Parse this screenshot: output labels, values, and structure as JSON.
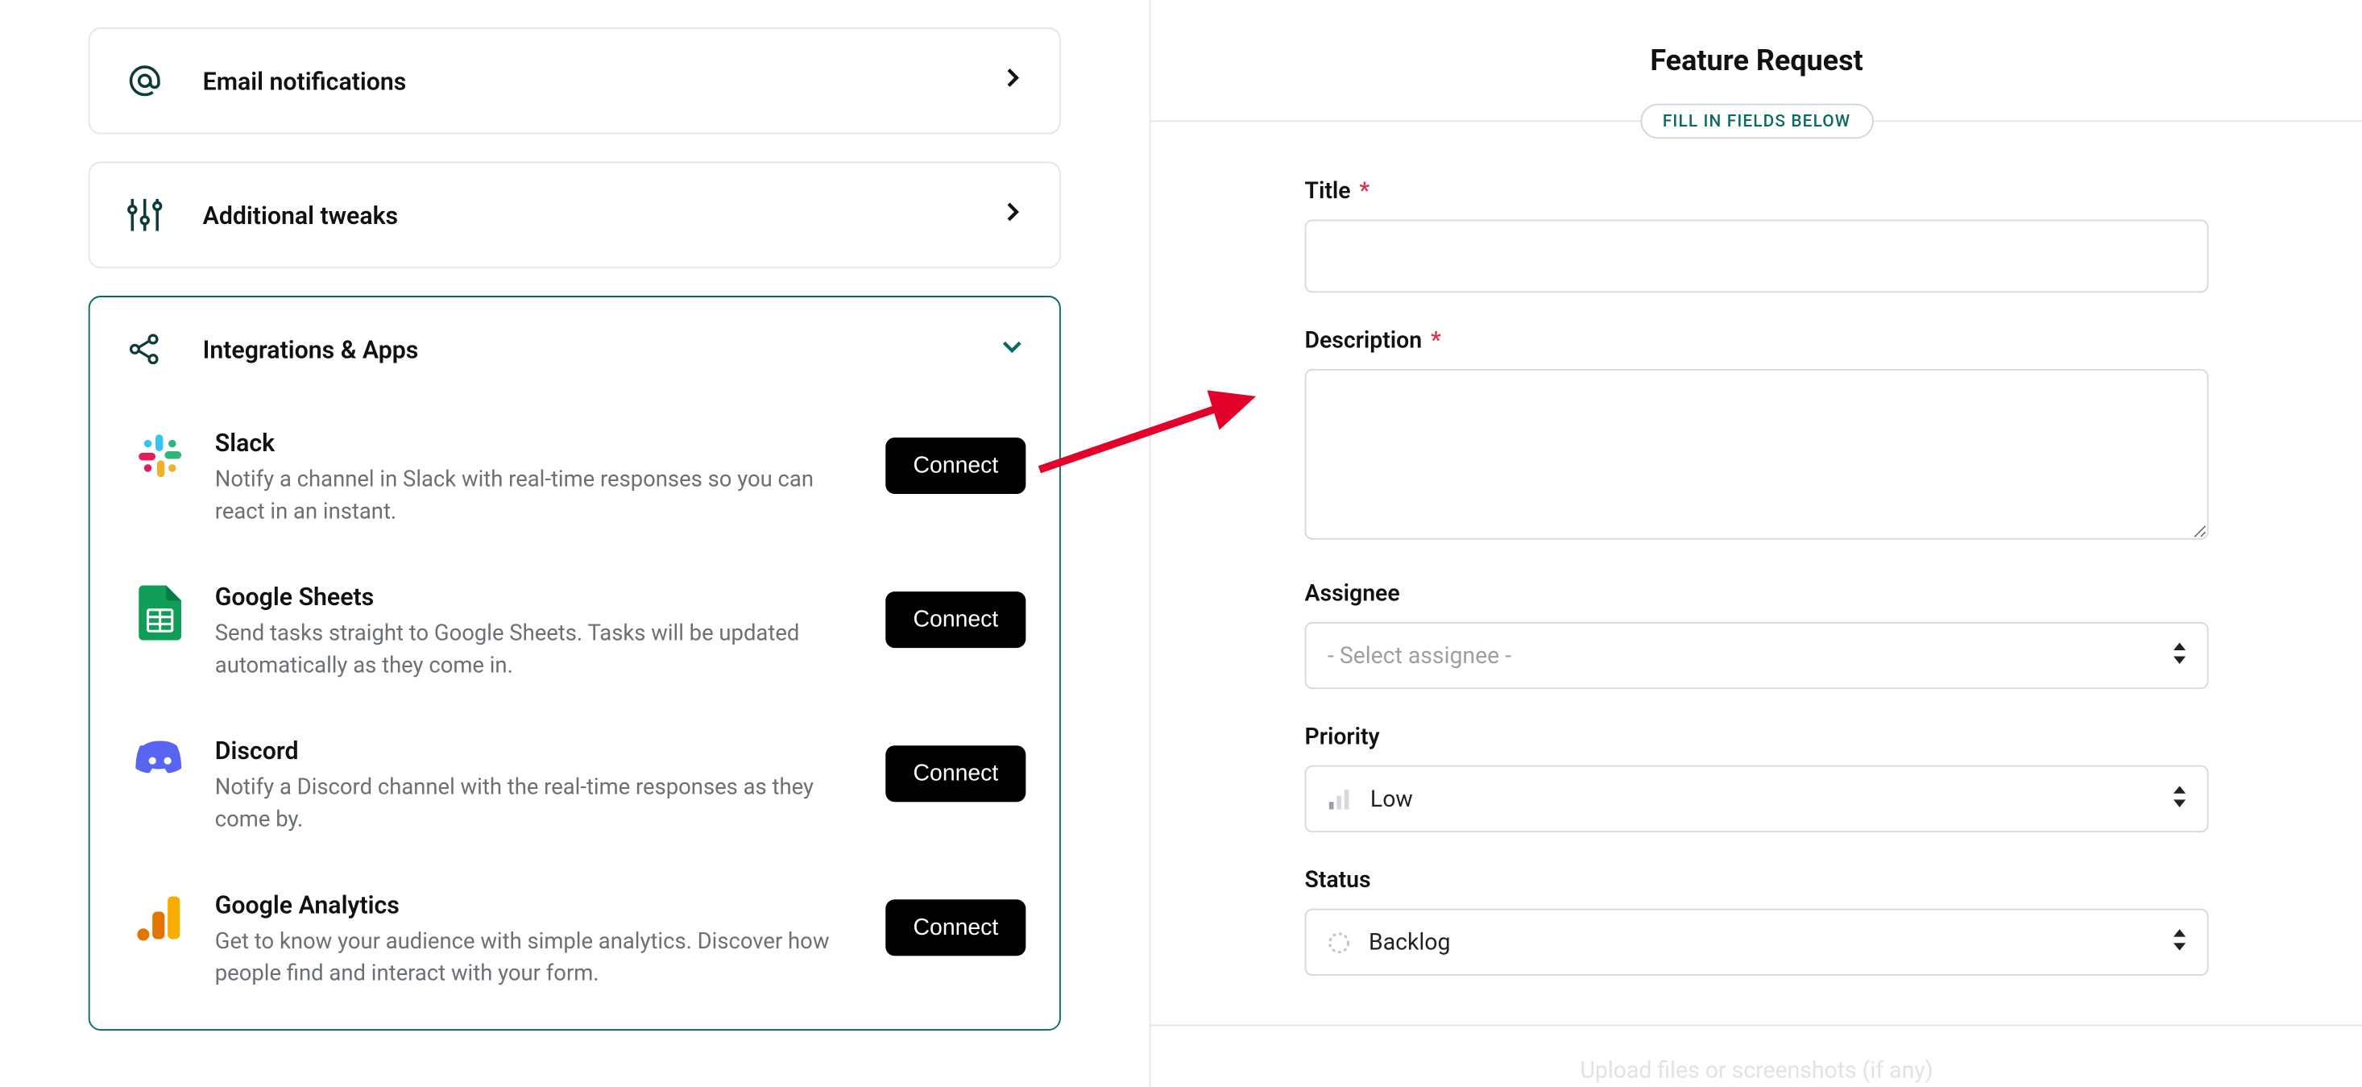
{
  "left": {
    "cards": {
      "email": {
        "label": "Email notifications"
      },
      "tweaks": {
        "label": "Additional tweaks"
      },
      "integrations": {
        "label": "Integrations & Apps",
        "items": [
          {
            "name": "Slack",
            "desc": "Notify a channel in Slack with real-time responses so you can react in an instant.",
            "button": "Connect"
          },
          {
            "name": "Google Sheets",
            "desc": "Send tasks straight to Google Sheets. Tasks will be updated automatically as they come in.",
            "button": "Connect"
          },
          {
            "name": "Discord",
            "desc": "Notify a Discord channel with the real-time responses as they come by.",
            "button": "Connect"
          },
          {
            "name": "Google Analytics",
            "desc": "Get to know your audience with simple analytics. Discover how people find and interact with your form.",
            "button": "Connect"
          }
        ]
      }
    }
  },
  "right": {
    "title": "Feature Request",
    "badge": "FILL IN FIELDS BELOW",
    "fields": {
      "title": {
        "label": "Title",
        "required": "*"
      },
      "description": {
        "label": "Description",
        "required": "*"
      },
      "assignee": {
        "label": "Assignee",
        "placeholder": "- Select assignee -"
      },
      "priority": {
        "label": "Priority",
        "value": "Low"
      },
      "status": {
        "label": "Status",
        "value": "Backlog"
      }
    },
    "footer_hint": "Upload files or screenshots (if any)"
  }
}
